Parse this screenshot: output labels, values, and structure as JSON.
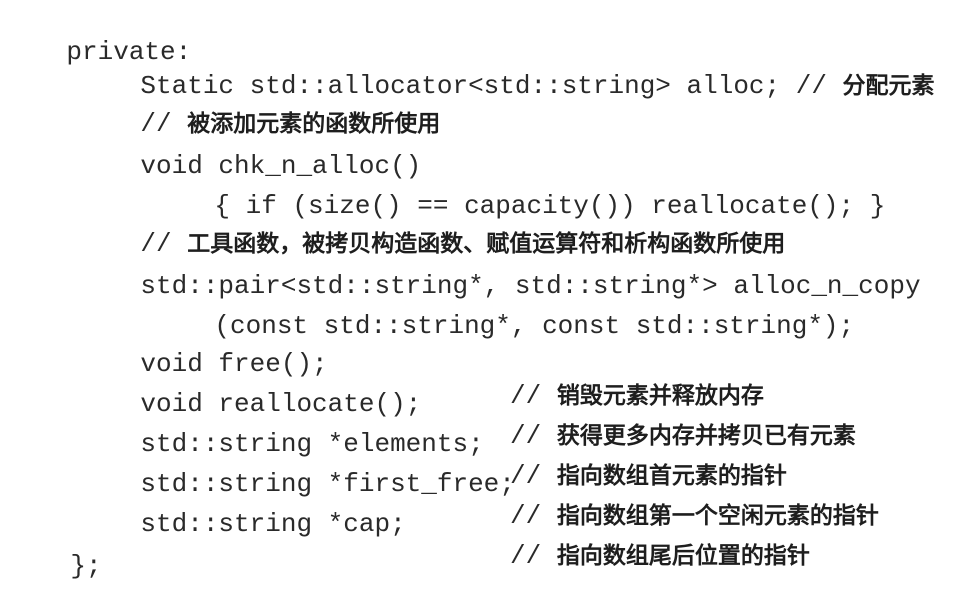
{
  "code_block": {
    "lines": [
      {
        "code": "private:"
      },
      {
        "code": "Static std::allocator<std::string> alloc; // ",
        "comment_text": "分配元素"
      },
      {
        "code": "// ",
        "comment_text": "被添加元素的函数所使用"
      },
      {
        "code": "void chk_n_alloc()"
      },
      {
        "code": "{ if (size() == capacity()) reallocate(); }"
      },
      {
        "code": "// ",
        "comment_text": "工具函数，被拷贝构造函数、赋值运算符和析构函数所使用"
      },
      {
        "code": "std::pair<std::string*, std::string*> alloc_n_copy"
      },
      {
        "code": "(const std::string*, const std::string*);"
      },
      {
        "code": "void free();",
        "comment_prefix": "// ",
        "comment_text": "销毁元素并释放内存"
      },
      {
        "code": "void reallocate();",
        "comment_prefix": "// ",
        "comment_text": "获得更多内存并拷贝已有元素"
      },
      {
        "code": "std::string *elements;",
        "comment_prefix": "// ",
        "comment_text": "指向数组首元素的指针"
      },
      {
        "code": "std::string *first_free;",
        "comment_prefix": "// ",
        "comment_text": "指向数组第一个空闲元素的指针"
      },
      {
        "code": "std::string *cap;",
        "comment_prefix": "// ",
        "comment_text": "指向数组尾后位置的指针"
      },
      {
        "code": "};"
      }
    ]
  }
}
